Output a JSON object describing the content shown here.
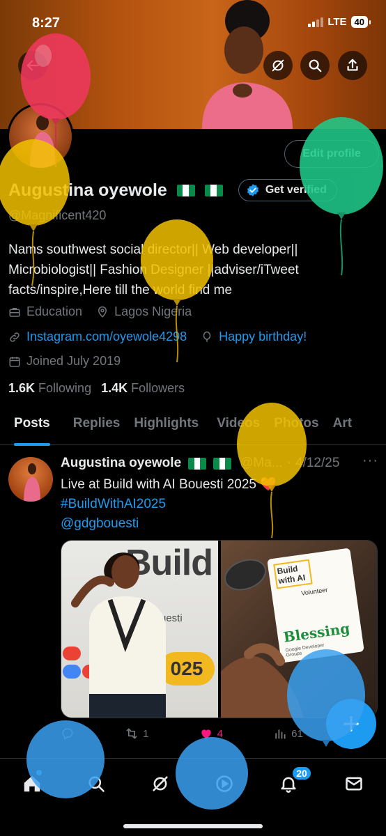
{
  "status_bar": {
    "time": "8:27",
    "network": "LTE",
    "battery": "40"
  },
  "header": {
    "back_icon": "arrow-left-icon",
    "grok_icon": "grok-icon",
    "search_icon": "search-icon",
    "share_icon": "share-icon"
  },
  "profile": {
    "edit_label": "Edit profile",
    "name": "Augustina oyewole",
    "get_verified_label": "Get verified",
    "handle": "@Magnificent420",
    "bio_line1": "Nams southwest social director|| Web developer||",
    "bio_line2": "Microbiologist|| Fashion Designer ||adviser/iTweet",
    "bio_line3": "facts/inspire,Here till the world find me",
    "category": "Education",
    "location": "Lagos Nigeria",
    "website": "Instagram.com/oyewole4298",
    "birthday": "Happy birthday!",
    "joined": "Joined July 2019",
    "following_count": "1.6K",
    "following_label": "Following",
    "followers_count": "1.4K",
    "followers_label": "Followers"
  },
  "tabs": [
    "Posts",
    "Replies",
    "Highlights",
    "Videos",
    "Photos",
    "Art"
  ],
  "post": {
    "author": "Augustina oyewole",
    "handle_trunc": "@Ma...",
    "date": "4/12/25",
    "more": "···",
    "text": "Live at Build with AI Bouesti 2025 ❤️",
    "hashtag": "#BuildWithAI2025",
    "mention": "@gdgbouesti",
    "image_left_text": "Build with A",
    "image_left_sub": "uesti",
    "image_left_badge": "025",
    "image_right_card_title": "Build with AI",
    "image_right_role": "Volunteer",
    "image_right_name": "Blessing",
    "image_right_org": "Google Developer Groups",
    "retweets": "1",
    "likes": "4",
    "views": "61"
  },
  "bottom_nav": {
    "notifications_badge": "20"
  },
  "colors": {
    "accent": "#1d9bf0",
    "like": "#f91880",
    "background": "#000000",
    "text_secondary": "#71767b",
    "balloon_red": "#f0385e",
    "balloon_yellow": "#f2c200",
    "balloon_green": "#1fc98a",
    "balloon_blue": "#3aa0f0"
  }
}
